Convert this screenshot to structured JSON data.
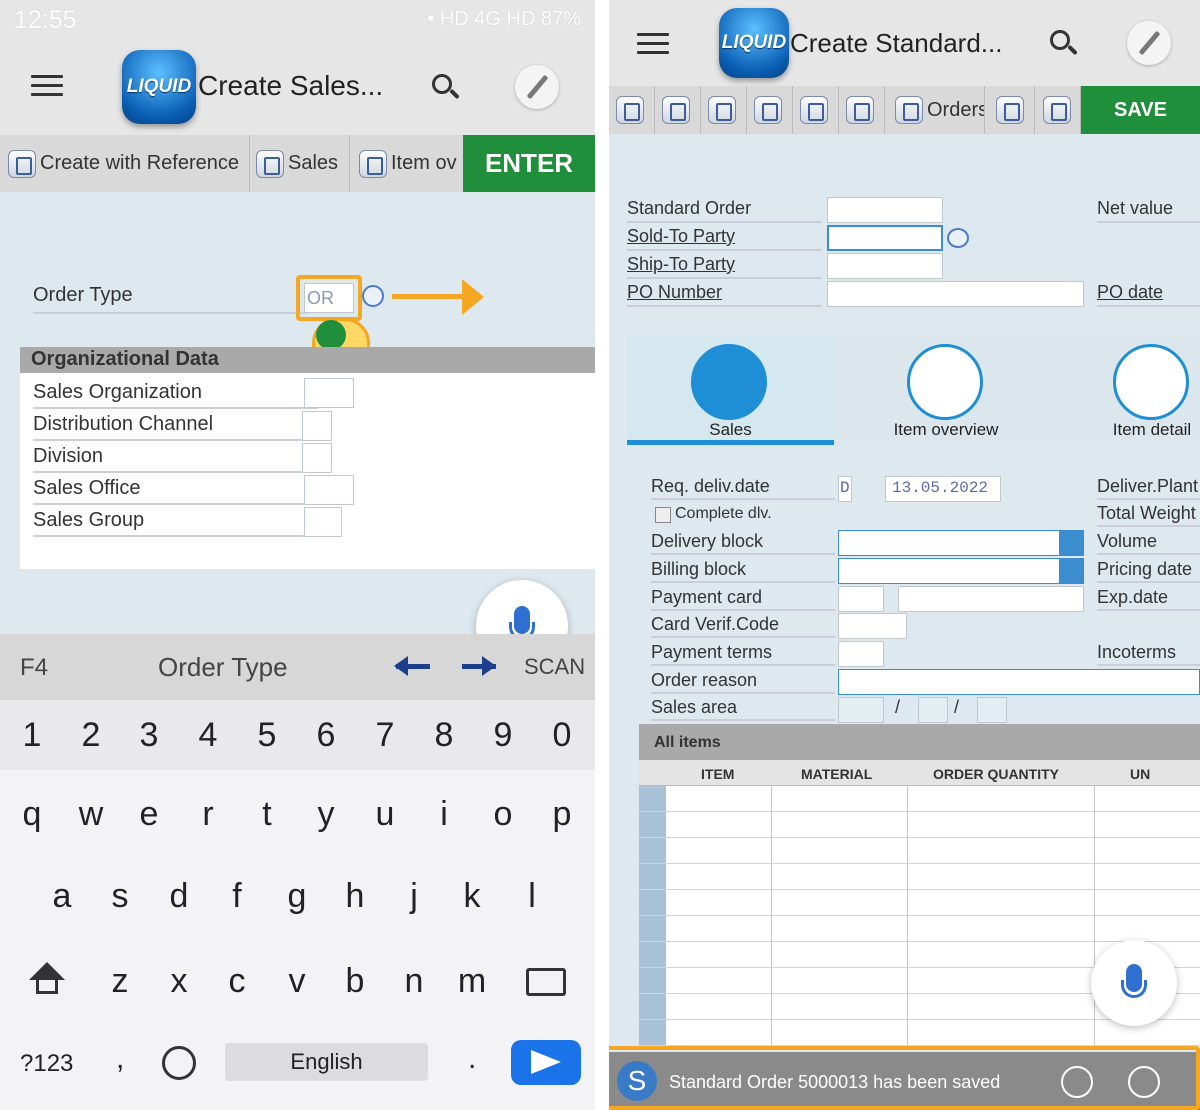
{
  "left": {
    "status": {
      "time": "12:55",
      "icons": "• HD 4G HD 87%"
    },
    "app_title": "Create Sales...",
    "logo_text": "LIQUID",
    "toolbar": {
      "create_ref": "Create with Reference",
      "sales": "Sales",
      "item_ov": "Item ov",
      "enter": "ENTER"
    },
    "order_type": {
      "label": "Order Type",
      "value": "OR"
    },
    "org_section": "Organizational Data",
    "org_fields": [
      "Sales Organization",
      "Distribution Channel",
      "Division",
      "Sales Office",
      "Sales Group"
    ],
    "bottom": {
      "f4": "F4",
      "title": "Order Type",
      "scan": "SCAN"
    },
    "keyboard": {
      "row1": [
        "1",
        "2",
        "3",
        "4",
        "5",
        "6",
        "7",
        "8",
        "9",
        "0"
      ],
      "row2": [
        "q",
        "w",
        "e",
        "r",
        "t",
        "y",
        "u",
        "i",
        "o",
        "p"
      ],
      "row3": [
        "a",
        "s",
        "d",
        "f",
        "g",
        "h",
        "j",
        "k",
        "l"
      ],
      "row4": [
        "z",
        "x",
        "c",
        "v",
        "b",
        "n",
        "m"
      ],
      "sym": "?123",
      "comma": ",",
      "space": "English",
      "period": "."
    }
  },
  "right": {
    "app_title": "Create Standard...",
    "logo_text": "LIQUID",
    "toolbar": {
      "orders": "Orders",
      "save": "SAVE"
    },
    "header_fields": {
      "standard_order": "Standard Order",
      "sold_to": "Sold-To Party",
      "ship_to": "Ship-To Party",
      "po_number": "PO Number",
      "net_value": "Net value",
      "po_date": "PO date"
    },
    "tabs": [
      "Sales",
      "Item overview",
      "Item detail"
    ],
    "sales_fields": {
      "req_deliv": "Req. deliv.date",
      "req_deliv_unit": "D",
      "req_deliv_value": "13.05.2022",
      "complete_dlv": "Complete dlv.",
      "delivery_block": "Delivery block",
      "billing_block": "Billing block",
      "payment_card": "Payment card",
      "card_verif": "Card Verif.Code",
      "payment_terms": "Payment terms",
      "order_reason": "Order reason",
      "sales_area": "Sales area",
      "sep": "/"
    },
    "right_labels": [
      "Deliver.Plant",
      "Total Weight",
      "Volume",
      "Pricing date",
      "Exp.date",
      "Incoterms"
    ],
    "items": {
      "title": "All items",
      "columns": [
        "ITEM",
        "MATERIAL",
        "ORDER QUANTITY",
        "UN"
      ]
    },
    "message": {
      "avatar": "S",
      "text": "Standard Order 5000013 has been saved"
    }
  }
}
